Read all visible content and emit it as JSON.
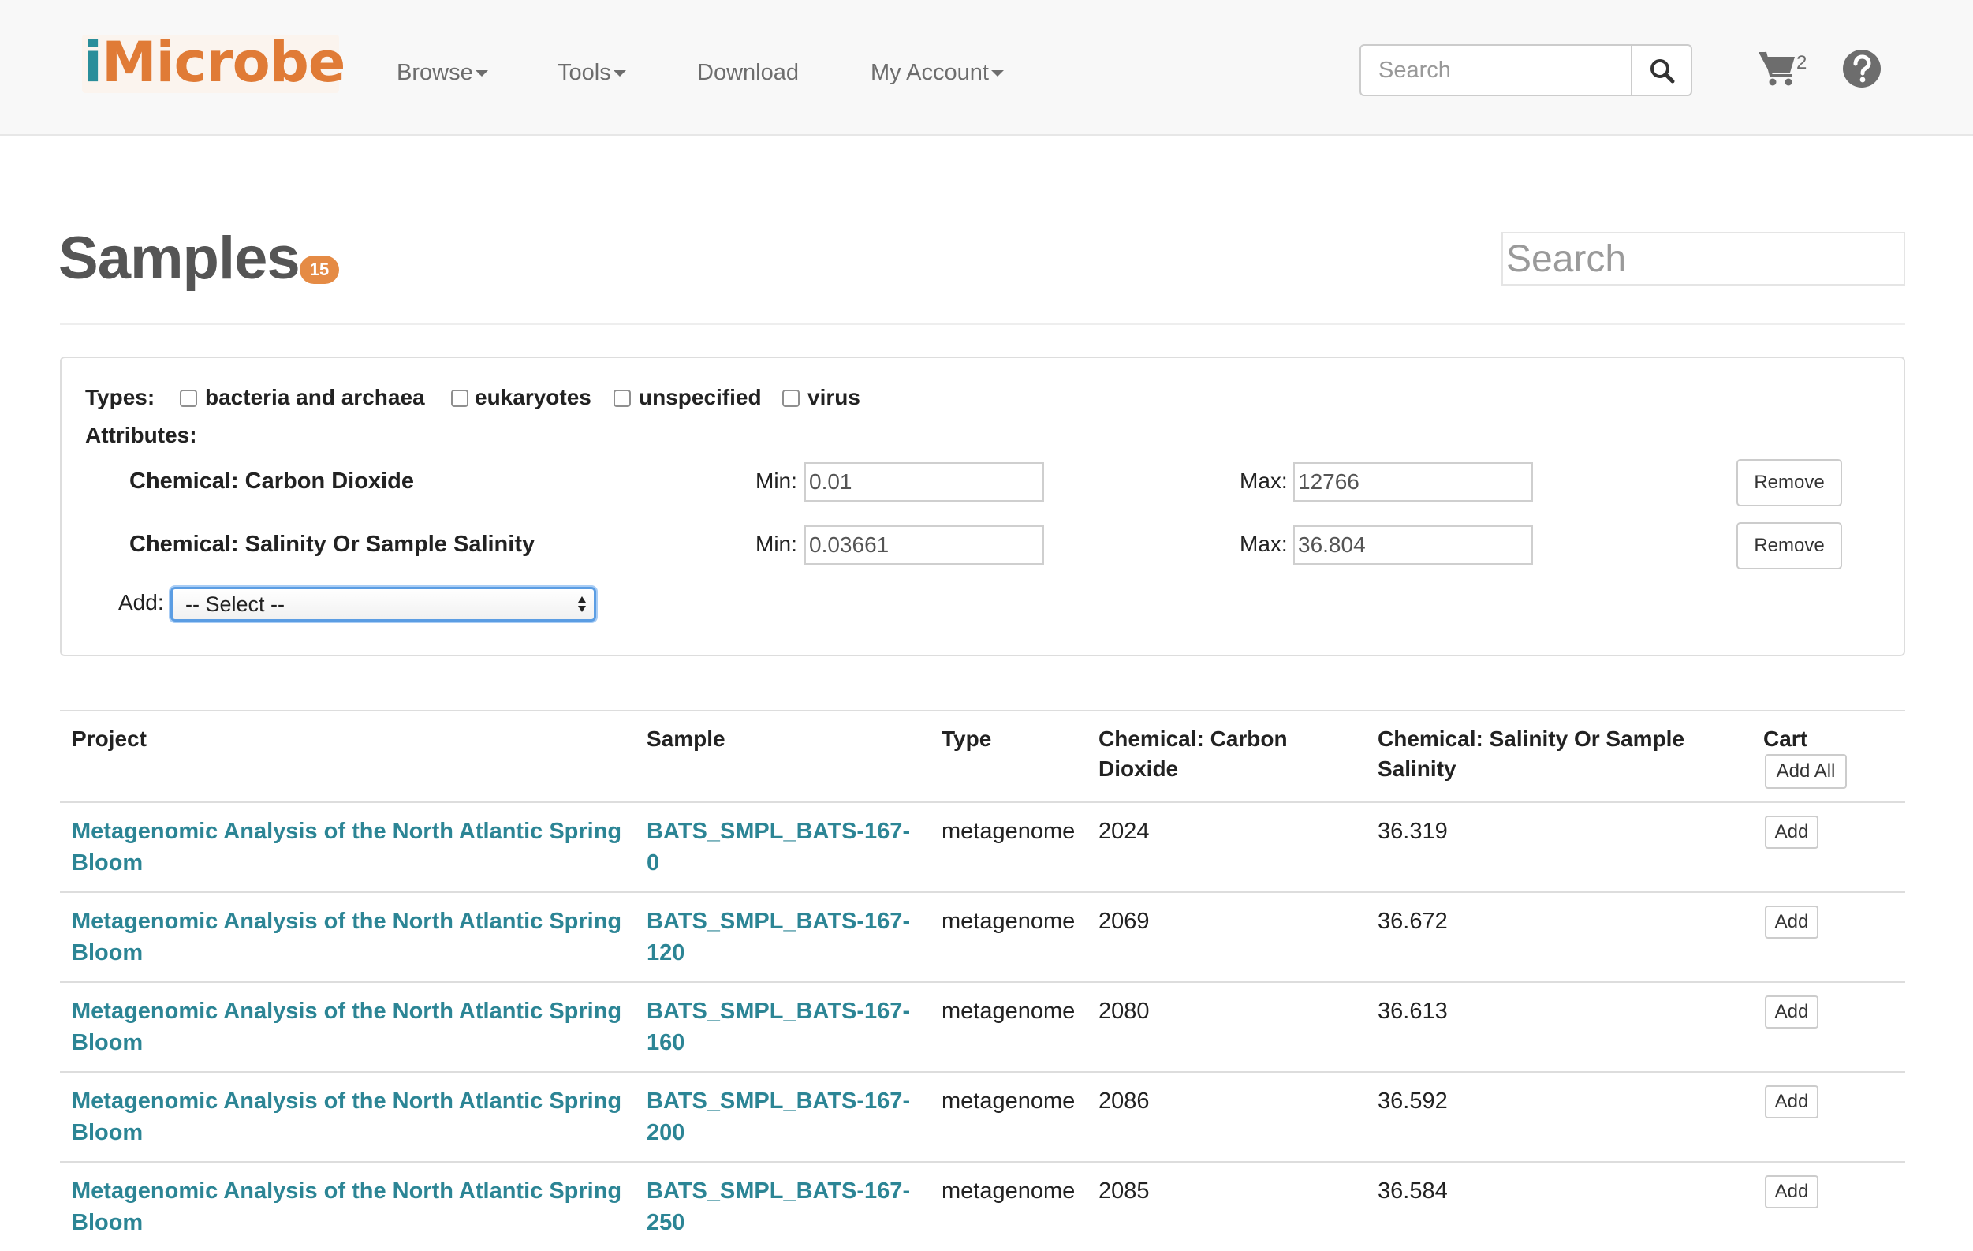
{
  "brand": {
    "name": "iMicrobe"
  },
  "nav": {
    "browse": "Browse",
    "tools": "Tools",
    "download": "Download",
    "my_account": "My Account",
    "search_placeholder": "Search",
    "cart_count": "2"
  },
  "page": {
    "title": "Samples",
    "count": "15",
    "search_placeholder": "Search"
  },
  "filters": {
    "types_label": "Types:",
    "types": [
      {
        "label": "bacteria and archaea",
        "checked": false
      },
      {
        "label": "eukaryotes",
        "checked": false
      },
      {
        "label": "unspecified",
        "checked": false
      },
      {
        "label": "virus",
        "checked": false
      }
    ],
    "attributes_label": "Attributes:",
    "attributes": [
      {
        "name": "Chemical: Carbon Dioxide",
        "min_label": "Min:",
        "min": "0.01",
        "max_label": "Max:",
        "max": "12766",
        "remove_label": "Remove"
      },
      {
        "name": "Chemical: Salinity Or Sample Salinity",
        "min_label": "Min:",
        "min": "0.03661",
        "max_label": "Max:",
        "max": "36.804",
        "remove_label": "Remove"
      }
    ],
    "add_label": "Add:",
    "add_select_value": "-- Select --"
  },
  "table": {
    "headers": {
      "project": "Project",
      "sample": "Sample",
      "type": "Type",
      "co2": "Chemical: Carbon Dioxide",
      "salinity": "Chemical: Salinity Or Sample Salinity",
      "cart": "Cart"
    },
    "add_all_label": "Add All",
    "add_label": "Add",
    "rows": [
      {
        "project": "Metagenomic Analysis of the North Atlantic Spring Bloom",
        "sample": "BATS_SMPL_BATS-167-0",
        "type": "metagenome",
        "co2": "2024",
        "salinity": "36.319"
      },
      {
        "project": "Metagenomic Analysis of the North Atlantic Spring Bloom",
        "sample": "BATS_SMPL_BATS-167-120",
        "type": "metagenome",
        "co2": "2069",
        "salinity": "36.672"
      },
      {
        "project": "Metagenomic Analysis of the North Atlantic Spring Bloom",
        "sample": "BATS_SMPL_BATS-167-160",
        "type": "metagenome",
        "co2": "2080",
        "salinity": "36.613"
      },
      {
        "project": "Metagenomic Analysis of the North Atlantic Spring Bloom",
        "sample": "BATS_SMPL_BATS-167-200",
        "type": "metagenome",
        "co2": "2086",
        "salinity": "36.592"
      },
      {
        "project": "Metagenomic Analysis of the North Atlantic Spring Bloom",
        "sample": "BATS_SMPL_BATS-167-250",
        "type": "metagenome",
        "co2": "2085",
        "salinity": "36.584"
      }
    ]
  },
  "colors": {
    "link": "#2c8595",
    "brand_orange": "#e07b36",
    "brand_teal": "#2a8e9a",
    "badge": "#e58b45"
  }
}
